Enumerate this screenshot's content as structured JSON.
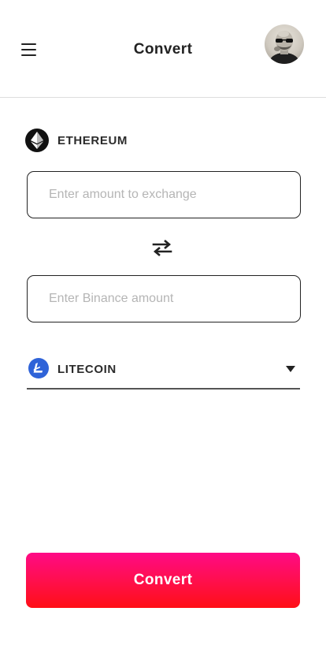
{
  "header": {
    "title": "Convert",
    "menu_icon": "hamburger-menu-icon",
    "avatar_alt": "user-avatar"
  },
  "from_coin": {
    "name": "ETHEREUM",
    "icon": "ethereum-icon",
    "icon_color": "#111111"
  },
  "exchange_input": {
    "value": "",
    "placeholder": "Enter amount to exchange"
  },
  "swap": {
    "icon": "swap-arrows-icon"
  },
  "receive_input": {
    "value": "",
    "placeholder": "Enter Binance amount"
  },
  "to_coin": {
    "name": "LITECOIN",
    "icon": "litecoin-icon",
    "icon_color": "#2f63d8"
  },
  "convert_button": {
    "label": "Convert",
    "gradient_top": "#ff0a86",
    "gradient_bottom": "#ff0f16"
  }
}
